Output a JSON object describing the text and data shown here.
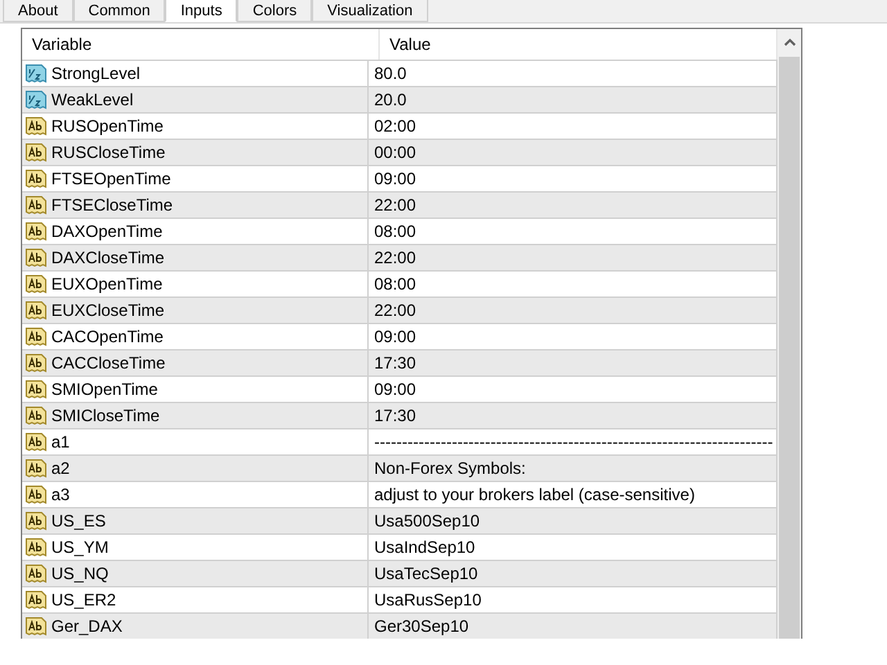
{
  "tabs": [
    {
      "label": "About",
      "selected": false
    },
    {
      "label": "Common",
      "selected": false
    },
    {
      "label": "Inputs",
      "selected": true
    },
    {
      "label": "Colors",
      "selected": false
    },
    {
      "label": "Visualization",
      "selected": false
    }
  ],
  "table": {
    "columns": [
      "Variable",
      "Value"
    ],
    "rows": [
      {
        "kind": "double",
        "variable": "StrongLevel",
        "value": "80.0"
      },
      {
        "kind": "double",
        "variable": "WeakLevel",
        "value": "20.0"
      },
      {
        "kind": "string",
        "variable": "RUSOpenTime",
        "value": "02:00"
      },
      {
        "kind": "string",
        "variable": "RUSCloseTime",
        "value": "00:00"
      },
      {
        "kind": "string",
        "variable": "FTSEOpenTime",
        "value": "09:00"
      },
      {
        "kind": "string",
        "variable": "FTSECloseTime",
        "value": "22:00"
      },
      {
        "kind": "string",
        "variable": "DAXOpenTime",
        "value": "08:00"
      },
      {
        "kind": "string",
        "variable": "DAXCloseTime",
        "value": "22:00"
      },
      {
        "kind": "string",
        "variable": "EUXOpenTime",
        "value": "08:00"
      },
      {
        "kind": "string",
        "variable": "EUXCloseTime",
        "value": "22:00"
      },
      {
        "kind": "string",
        "variable": "CACOpenTime",
        "value": "09:00"
      },
      {
        "kind": "string",
        "variable": "CACCloseTime",
        "value": "17:30"
      },
      {
        "kind": "string",
        "variable": "SMIOpenTime",
        "value": "09:00"
      },
      {
        "kind": "string",
        "variable": "SMICloseTime",
        "value": "17:30"
      },
      {
        "kind": "string",
        "variable": "a1",
        "value": "------------------------------------------------------------------------"
      },
      {
        "kind": "string",
        "variable": "a2",
        "value": "Non-Forex Symbols:"
      },
      {
        "kind": "string",
        "variable": "a3",
        "value": "adjust to your brokers label (case-sensitive)"
      },
      {
        "kind": "string",
        "variable": "US_ES",
        "value": "Usa500Sep10"
      },
      {
        "kind": "string",
        "variable": "US_YM",
        "value": "UsaIndSep10"
      },
      {
        "kind": "string",
        "variable": "US_NQ",
        "value": "UsaTecSep10"
      },
      {
        "kind": "string",
        "variable": "US_ER2",
        "value": "UsaRusSep10"
      },
      {
        "kind": "string",
        "variable": "Ger_DAX",
        "value": "Ger30Sep10"
      }
    ]
  }
}
